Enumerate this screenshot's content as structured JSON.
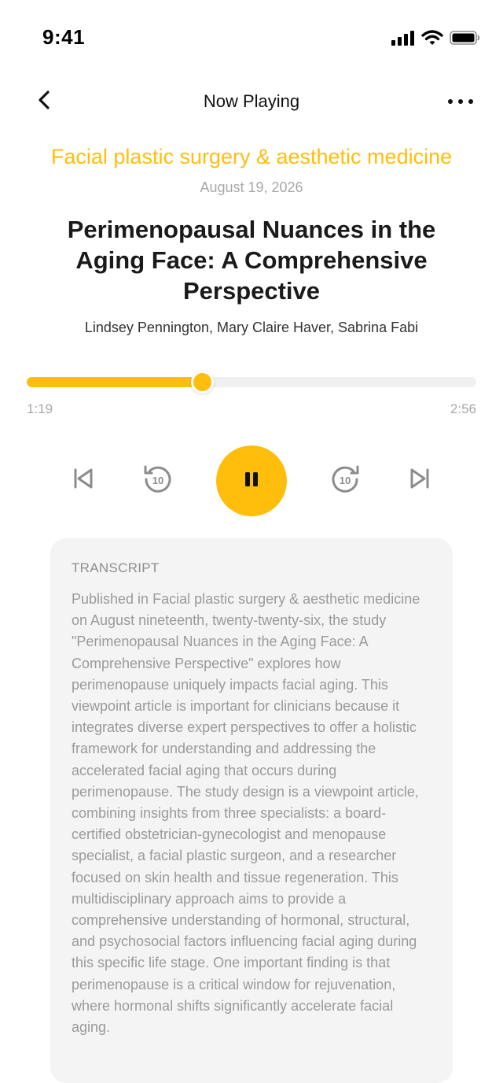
{
  "status_bar": {
    "time": "9:41"
  },
  "nav": {
    "title": "Now Playing"
  },
  "episode": {
    "journal": "Facial plastic surgery & aesthetic medicine",
    "date": "August 19, 2026",
    "title": "Perimenopausal Nuances in the Aging Face: A Comprehensive Perspective",
    "authors": "Lindsey Pennington, Mary Claire Haver, Sabrina Fabi"
  },
  "player": {
    "elapsed": "1:19",
    "total": "2:56",
    "progress_fraction": 0.39,
    "state": "playing",
    "accent_color": "#FFBE0B"
  },
  "transcript": {
    "heading": "TRANSCRIPT",
    "text": "Published in Facial plastic surgery & aesthetic medicine on August nineteenth, twenty-twenty-six, the study \"Perimenopausal Nuances in the Aging Face: A Comprehensive Perspective\" explores how perimenopause uniquely impacts facial aging. This viewpoint article is important for clinicians because it integrates diverse expert perspectives to offer a holistic framework for understanding and addressing the accelerated facial aging that occurs during perimenopause. The study design is a viewpoint article, combining insights from three specialists: a board-certified obstetrician-gynecologist and menopause specialist, a facial plastic surgeon, and a researcher focused on skin health and tissue regeneration. This multidisciplinary approach aims to provide a comprehensive understanding of hormonal, structural, and psychosocial factors influencing facial aging during this specific life stage. One important finding is that perimenopause is a critical window for rejuvenation, where hormonal shifts significantly accelerate facial aging."
  },
  "icons": {
    "back": "chevron-left-icon",
    "more": "more-horizontal-icon",
    "prev": "skip-previous-icon",
    "rewind": "rewind-10-icon",
    "play_pause": "pause-icon",
    "forward": "forward-10-icon",
    "next": "skip-next-icon"
  }
}
